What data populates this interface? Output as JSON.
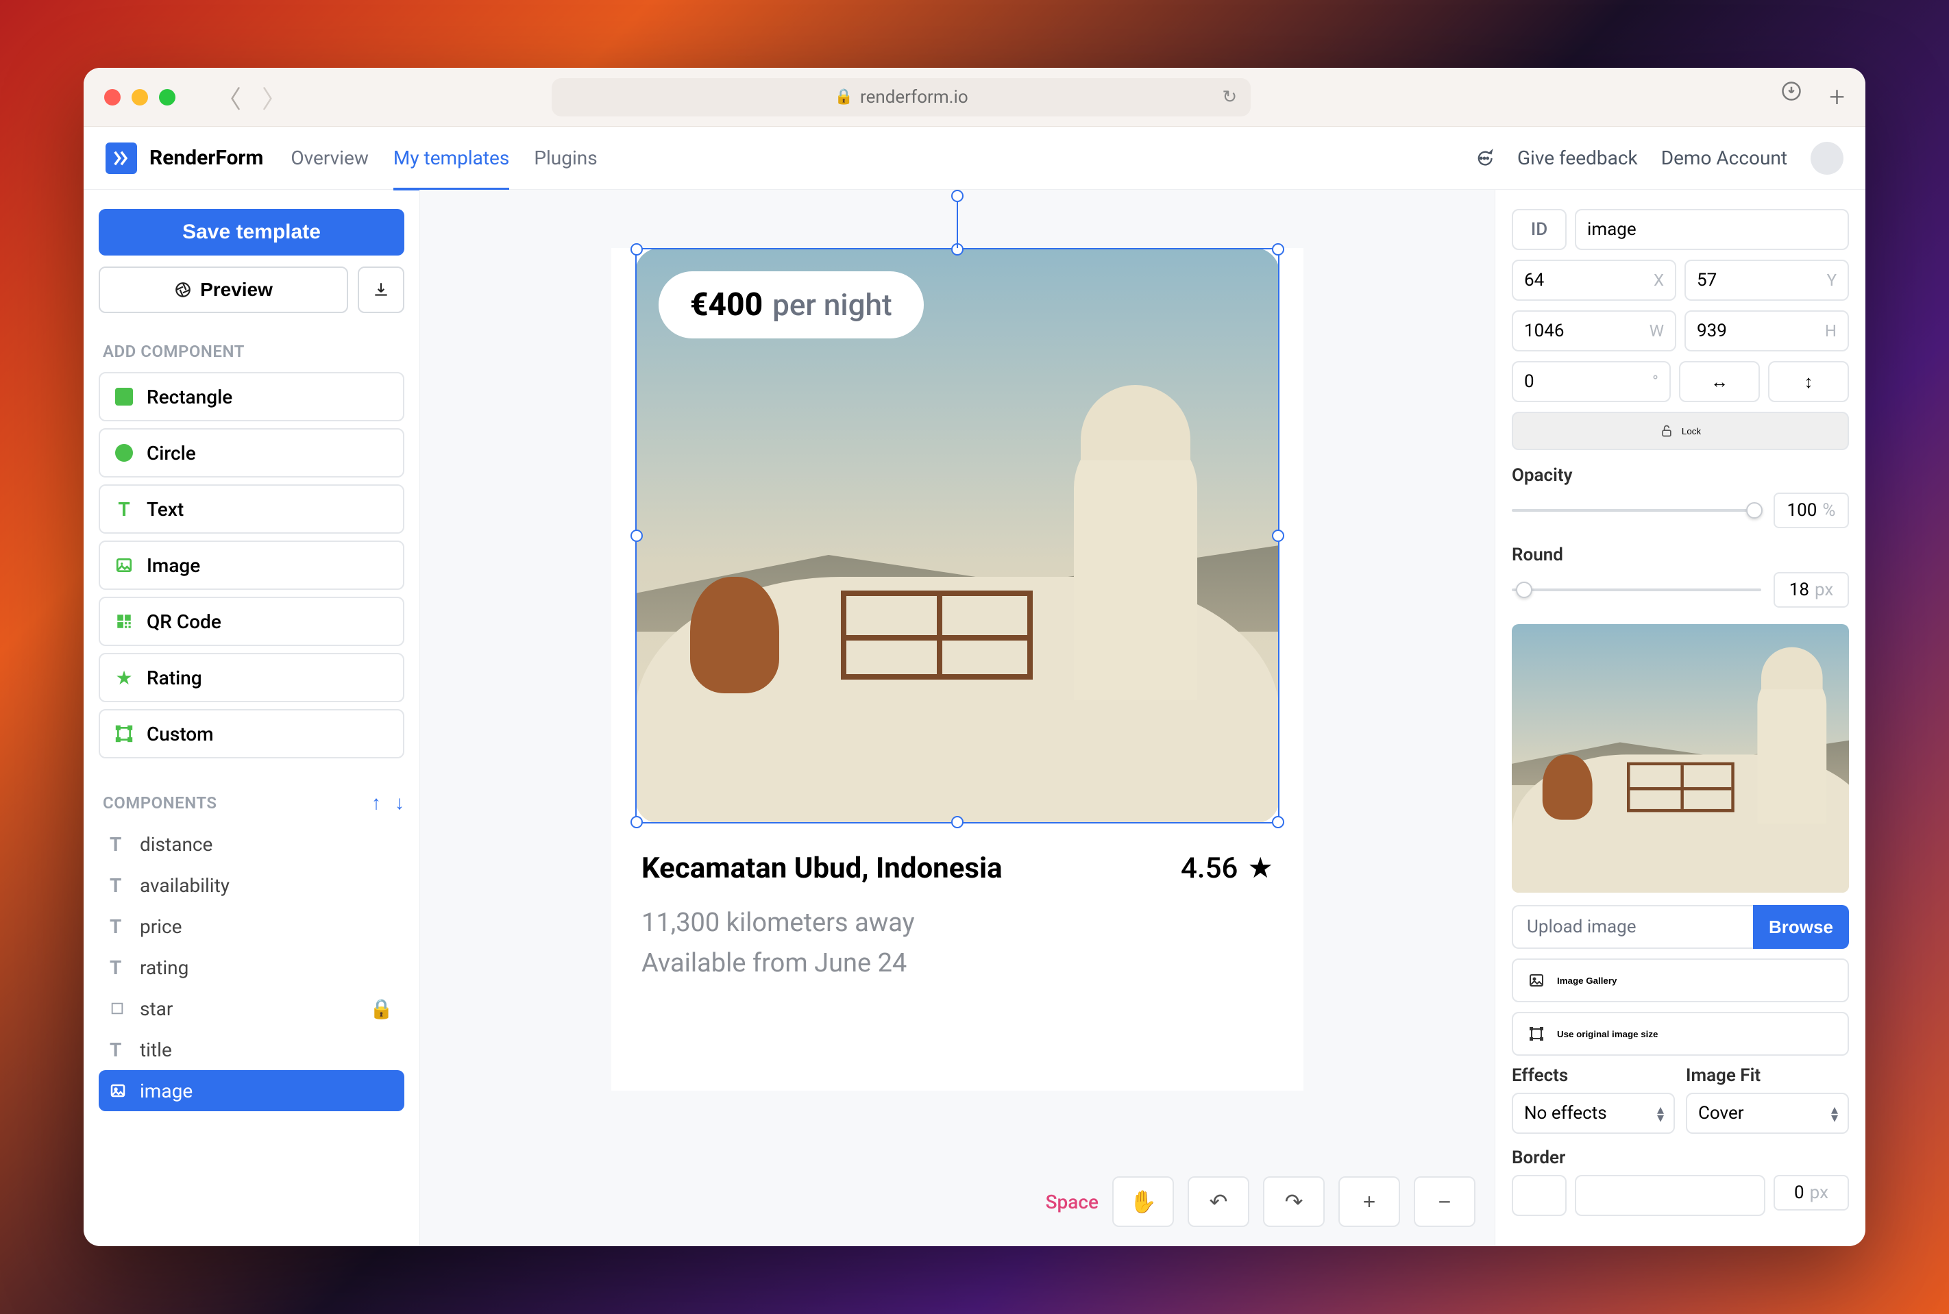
{
  "browser": {
    "url": "renderform.io"
  },
  "app": {
    "brand": "RenderForm",
    "nav": {
      "overview": "Overview",
      "templates": "My templates",
      "plugins": "Plugins"
    },
    "feedback": "Give feedback",
    "account": "Demo Account"
  },
  "sidebar": {
    "save": "Save template",
    "preview": "Preview",
    "add_label": "ADD COMPONENT",
    "add": {
      "rectangle": "Rectangle",
      "circle": "Circle",
      "text": "Text",
      "image": "Image",
      "qrcode": "QR Code",
      "rating": "Rating",
      "custom": "Custom"
    },
    "components_label": "COMPONENTS",
    "layers": {
      "distance": "distance",
      "availability": "availability",
      "price": "price",
      "rating": "rating",
      "star": "star",
      "title": "title",
      "image": "image"
    }
  },
  "canvas": {
    "price_amount": "€400",
    "price_suffix": "per night",
    "title": "Kecamatan Ubud, Indonesia",
    "rating": "4.56",
    "distance": "11,300 kilometers away",
    "availability": "Available from June 24",
    "space": "Space"
  },
  "inspector": {
    "id_label": "ID",
    "id_value": "image",
    "x": "64",
    "y": "57",
    "w": "1046",
    "h": "939",
    "rotate": "0",
    "lock": "Lock",
    "opacity_label": "Opacity",
    "opacity_value": "100",
    "opacity_unit": "%",
    "round_label": "Round",
    "round_value": "18",
    "round_unit": "px",
    "upload_placeholder": "Upload image",
    "browse": "Browse",
    "gallery": "Image Gallery",
    "original": "Use original image size",
    "effects_label": "Effects",
    "effects_value": "No effects",
    "fit_label": "Image Fit",
    "fit_value": "Cover",
    "border_label": "Border",
    "border_value": "0",
    "border_unit": "px"
  }
}
